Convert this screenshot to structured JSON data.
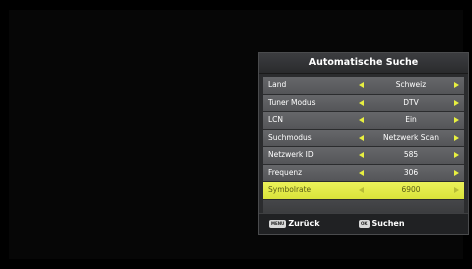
{
  "menu": {
    "title": "Automatische Suche",
    "rows": [
      {
        "label": "Land",
        "value": "Schweiz"
      },
      {
        "label": "Tuner Modus",
        "value": "DTV"
      },
      {
        "label": "LCN",
        "value": "Ein"
      },
      {
        "label": "Suchmodus",
        "value": "Netzwerk Scan"
      },
      {
        "label": "Netzwerk ID",
        "value": "585"
      },
      {
        "label": "Frequenz",
        "value": "306"
      },
      {
        "label": "Symbolrate",
        "value": "6900"
      }
    ],
    "selected_index": 6
  },
  "footer": {
    "back_key": "MENU",
    "back_label": "Zurück",
    "search_key": "OK",
    "search_label": "Suchen"
  },
  "colors": {
    "highlight": "#e2ea48",
    "arrow": "#e8f040",
    "row": "#5e5f62",
    "panel": "#2b2c2e"
  }
}
